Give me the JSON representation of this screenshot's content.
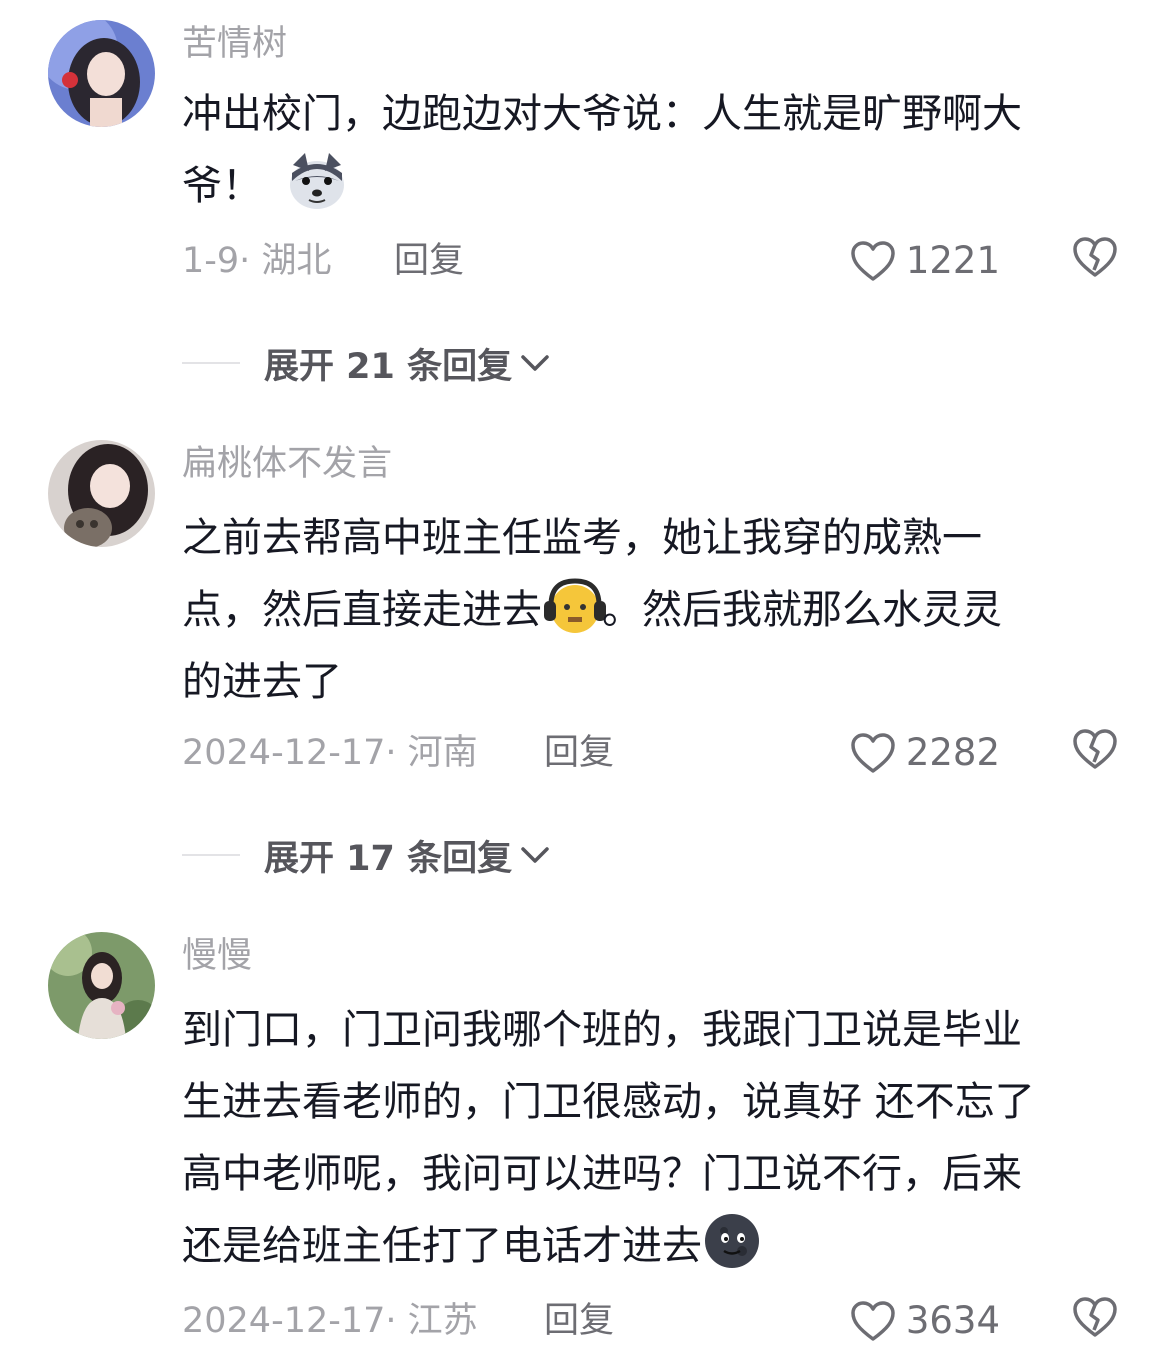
{
  "comments": [
    {
      "username": "苦情树",
      "lines": [
        "冲出校门，边跑边对大爷说：人生就是旷野啊大",
        "爷！"
      ],
      "date": "1-9· 湖北",
      "reply_label": "回复",
      "likes": "1221",
      "expand_label": "展开 21 条回复",
      "avatar_icon": "avatar-girl-blue",
      "emoji": "husky-emoji"
    },
    {
      "username": "扁桃体不发言",
      "lines": [
        "之前去帮高中班主任监考，她让我穿的成熟一",
        "点，然后直接走进去",
        "。然后我就那么水灵灵",
        "的进去了"
      ],
      "date": "2024-12-17· 河南",
      "reply_label": "回复",
      "likes": "2282",
      "expand_label": "展开 17 条回复",
      "avatar_icon": "avatar-girl-cat",
      "emoji": "headphone-face-emoji"
    },
    {
      "username": "慢慢",
      "lines": [
        "到门口，门卫问我哪个班的，我跟门卫说是毕业",
        "生进去看老师的，门卫很感动，说真好 还不忘了",
        "高中老师呢，我问可以进吗？门卫说不行，后来",
        "还是给班主任打了电话才进去"
      ],
      "date": "2024-12-17· 江苏",
      "reply_label": "回复",
      "likes": "3634",
      "avatar_icon": "avatar-girl-garden",
      "emoji": "new-moon-face-emoji"
    }
  ]
}
